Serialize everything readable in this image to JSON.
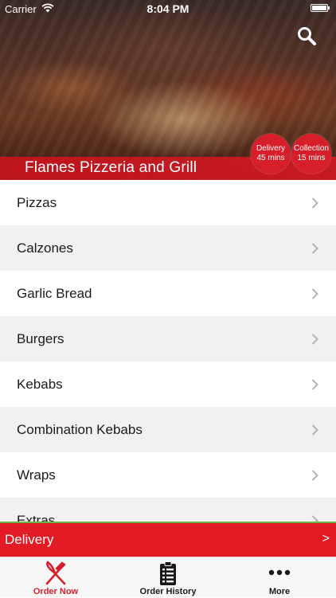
{
  "status_bar": {
    "carrier": "Carrier",
    "time": "8:04 PM"
  },
  "header": {
    "restaurant_name": "Flames Pizzeria and Grill",
    "badges": {
      "delivery": {
        "label": "Delivery",
        "time": "45 mins"
      },
      "collection": {
        "label": "Collection",
        "time": "15 mins"
      }
    }
  },
  "menu": {
    "items": [
      {
        "label": "Pizzas"
      },
      {
        "label": "Calzones"
      },
      {
        "label": "Garlic Bread"
      },
      {
        "label": "Burgers"
      },
      {
        "label": "Kebabs"
      },
      {
        "label": "Combination Kebabs"
      },
      {
        "label": "Wraps"
      },
      {
        "label": "Extras"
      }
    ]
  },
  "delivery_bar": {
    "label": "Delivery",
    "arrow": ">"
  },
  "tab_bar": {
    "tabs": [
      {
        "label": "Order Now",
        "icon": "fork-knife-icon",
        "active": true
      },
      {
        "label": "Order History",
        "icon": "clipboard-list-icon",
        "active": false
      },
      {
        "label": "More",
        "icon": "more-dots-icon",
        "active": false
      }
    ]
  },
  "colors": {
    "brand_red": "#d61f2a",
    "delivery_bar": "#e31b25",
    "accent_green": "#6db33f"
  }
}
